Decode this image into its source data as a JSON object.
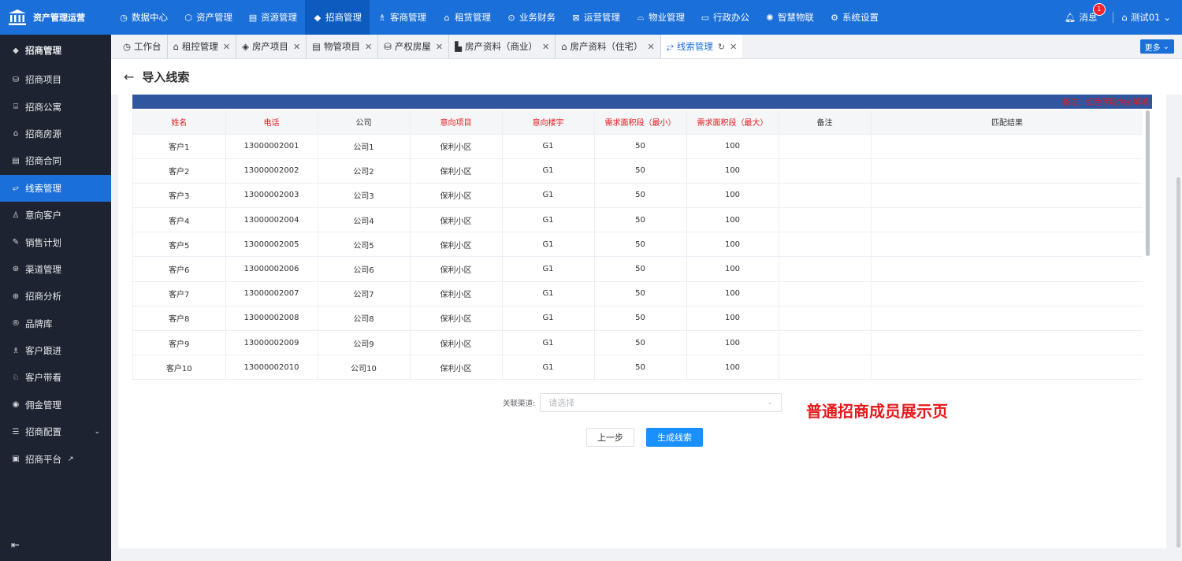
{
  "app": {
    "title": "资产管理运营"
  },
  "topnav": {
    "items": [
      {
        "label": "数据中心",
        "icon": "dashboard-icon"
      },
      {
        "label": "资产管理",
        "icon": "cube-icon"
      },
      {
        "label": "资源管理",
        "icon": "building-icon"
      },
      {
        "label": "招商管理",
        "icon": "tag-icon"
      },
      {
        "label": "客商管理",
        "icon": "users-icon"
      },
      {
        "label": "租赁管理",
        "icon": "home-icon"
      },
      {
        "label": "业务财务",
        "icon": "coin-icon"
      },
      {
        "label": "运营管理",
        "icon": "chart-icon"
      },
      {
        "label": "物业管理",
        "icon": "building2-icon"
      },
      {
        "label": "行政办公",
        "icon": "monitor-icon"
      },
      {
        "label": "智慧物联",
        "icon": "iot-icon"
      },
      {
        "label": "系统设置",
        "icon": "gear-icon"
      }
    ],
    "message_label": "消息",
    "message_count": "1",
    "user_name": "测试01"
  },
  "sidebar": {
    "header": "招商管理",
    "items": [
      {
        "label": "招商项目"
      },
      {
        "label": "招商公寓"
      },
      {
        "label": "招商房源"
      },
      {
        "label": "招商合同"
      },
      {
        "label": "线索管理"
      },
      {
        "label": "意向客户"
      },
      {
        "label": "销售计划"
      },
      {
        "label": "渠道管理"
      },
      {
        "label": "招商分析"
      },
      {
        "label": "品牌库"
      },
      {
        "label": "客户跟进"
      },
      {
        "label": "客户带看"
      },
      {
        "label": "佣金管理"
      },
      {
        "label": "招商配置"
      },
      {
        "label": "招商平台"
      }
    ]
  },
  "tabs": {
    "items": [
      {
        "label": "工作台"
      },
      {
        "label": "租控管理"
      },
      {
        "label": "房产项目"
      },
      {
        "label": "物管项目"
      },
      {
        "label": "产权房屋"
      },
      {
        "label": "房产资料（商业）"
      },
      {
        "label": "房产资料（住宅）"
      },
      {
        "label": "线索管理"
      }
    ],
    "more_label": "更多"
  },
  "page": {
    "title": "导入线索",
    "banner_note": "备注：红色字段为必填项"
  },
  "table": {
    "headers": [
      "姓名",
      "电话",
      "公司",
      "意向项目",
      "意向楼宇",
      "需求面积段（最小）",
      "需求面积段（最大）",
      "备注",
      "匹配结果"
    ],
    "rows": [
      [
        "客户1",
        "13000002001",
        "公司1",
        "保利小区",
        "G1",
        "50",
        "100",
        "",
        ""
      ],
      [
        "客户2",
        "13000002002",
        "公司2",
        "保利小区",
        "G1",
        "50",
        "100",
        "",
        ""
      ],
      [
        "客户3",
        "13000002003",
        "公司3",
        "保利小区",
        "G1",
        "50",
        "100",
        "",
        ""
      ],
      [
        "客户4",
        "13000002004",
        "公司4",
        "保利小区",
        "G1",
        "50",
        "100",
        "",
        ""
      ],
      [
        "客户5",
        "13000002005",
        "公司5",
        "保利小区",
        "G1",
        "50",
        "100",
        "",
        ""
      ],
      [
        "客户6",
        "13000002006",
        "公司6",
        "保利小区",
        "G1",
        "50",
        "100",
        "",
        ""
      ],
      [
        "客户7",
        "13000002007",
        "公司7",
        "保利小区",
        "G1",
        "50",
        "100",
        "",
        ""
      ],
      [
        "客户8",
        "13000002008",
        "公司8",
        "保利小区",
        "G1",
        "50",
        "100",
        "",
        ""
      ],
      [
        "客户9",
        "13000002009",
        "公司9",
        "保利小区",
        "G1",
        "50",
        "100",
        "",
        ""
      ],
      [
        "客户10",
        "13000002010",
        "公司10",
        "保利小区",
        "G1",
        "50",
        "100",
        "",
        ""
      ]
    ]
  },
  "form": {
    "channel_label": "关联渠道:",
    "channel_placeholder": "请选择"
  },
  "annotation": "普通招商成员展示页",
  "buttons": {
    "prev": "上一步",
    "generate": "生成线索"
  },
  "colors": {
    "brand": "#1a6fd9",
    "sidebar_bg": "#1d2330",
    "required": "#e6191c",
    "banner": "#2f569f"
  }
}
